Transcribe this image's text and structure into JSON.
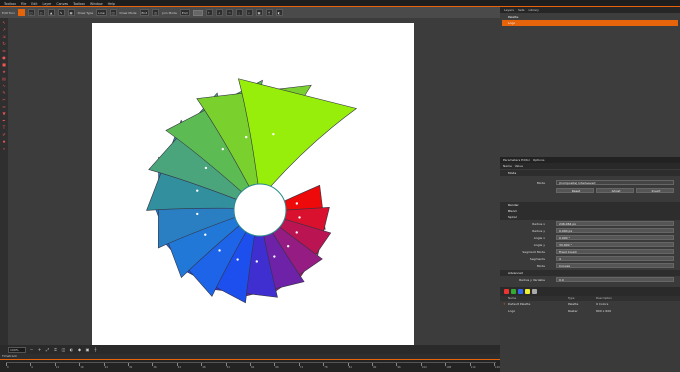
{
  "menu": [
    "Toolbox",
    "File",
    "Edit",
    "Layer",
    "Canvas",
    "Toolbox",
    "Window",
    "Help"
  ],
  "toolbar": {
    "edit_tool": "Edit Tool",
    "draw_type_label": "Draw Type",
    "draw_type": "Line",
    "draw_mode_label": "Draw Mode",
    "draw_mode": "End",
    "join_mode_label": "Join Mode",
    "join_mode": "End"
  },
  "statusbar": {
    "zoom": "100%"
  },
  "timeline": {
    "title": "Timetrack",
    "ticks": [
      "0",
      "6",
      "12",
      "18",
      "24",
      "30",
      "36",
      "42",
      "48",
      "54",
      "60",
      "66",
      "72",
      "78",
      "84",
      "90",
      "96",
      "102",
      "108",
      "114",
      "120"
    ]
  },
  "right": {
    "tabs": [
      "Layers",
      "Sets",
      "Library"
    ],
    "layers": [
      "Palette",
      "Logo"
    ],
    "params_tabs": [
      "Parameters Editor",
      "Options",
      "Meta"
    ],
    "params_header": [
      "Name",
      "Value",
      "Time Track"
    ],
    "mode_section": "Mode",
    "mode_label": "Mode",
    "mode_value": "(Composite) Interleaved",
    "mode_buttons": [
      "Reset",
      "Ghost",
      "Invert"
    ],
    "sections": {
      "render": "Render",
      "blend": "Blend",
      "spiral": "Spiral",
      "advanced": "Advanced"
    },
    "params": [
      {
        "label": "Radius x",
        "value": "246.064 px"
      },
      {
        "label": "Radius y",
        "value": "0.000 px"
      },
      {
        "label": "Angle x",
        "value": "0.000 °"
      },
      {
        "label": "Angle y",
        "value": "33.000 °"
      },
      {
        "label": "Segment Mode",
        "value": "Fixed Count"
      },
      {
        "label": "Segments",
        "value": "4"
      },
      {
        "label": "Mode",
        "value": "Convex"
      }
    ],
    "advanced_row": {
      "label": "Radius y Variable",
      "value": "0.0"
    },
    "library": {
      "columns": [
        "Name",
        "Type",
        "Description"
      ],
      "rows": [
        {
          "name": "Default Palette",
          "type": "Palette",
          "desc": "9 Colors"
        },
        {
          "name": "Logo",
          "type": "Raster",
          "desc": "800 x 600"
        }
      ]
    }
  },
  "chart_data": {
    "type": "radial-petals",
    "petal_colors": [
      "#ee0a0a",
      "#d9102e",
      "#bb1452",
      "#941c82",
      "#6e22a8",
      "#3f2fd0",
      "#1c4fee",
      "#1d64e8",
      "#2278d6",
      "#2a7fc2",
      "#328f9e",
      "#4aa57c",
      "#5dbb54",
      "#7ad12e",
      "#96ee0a"
    ]
  }
}
